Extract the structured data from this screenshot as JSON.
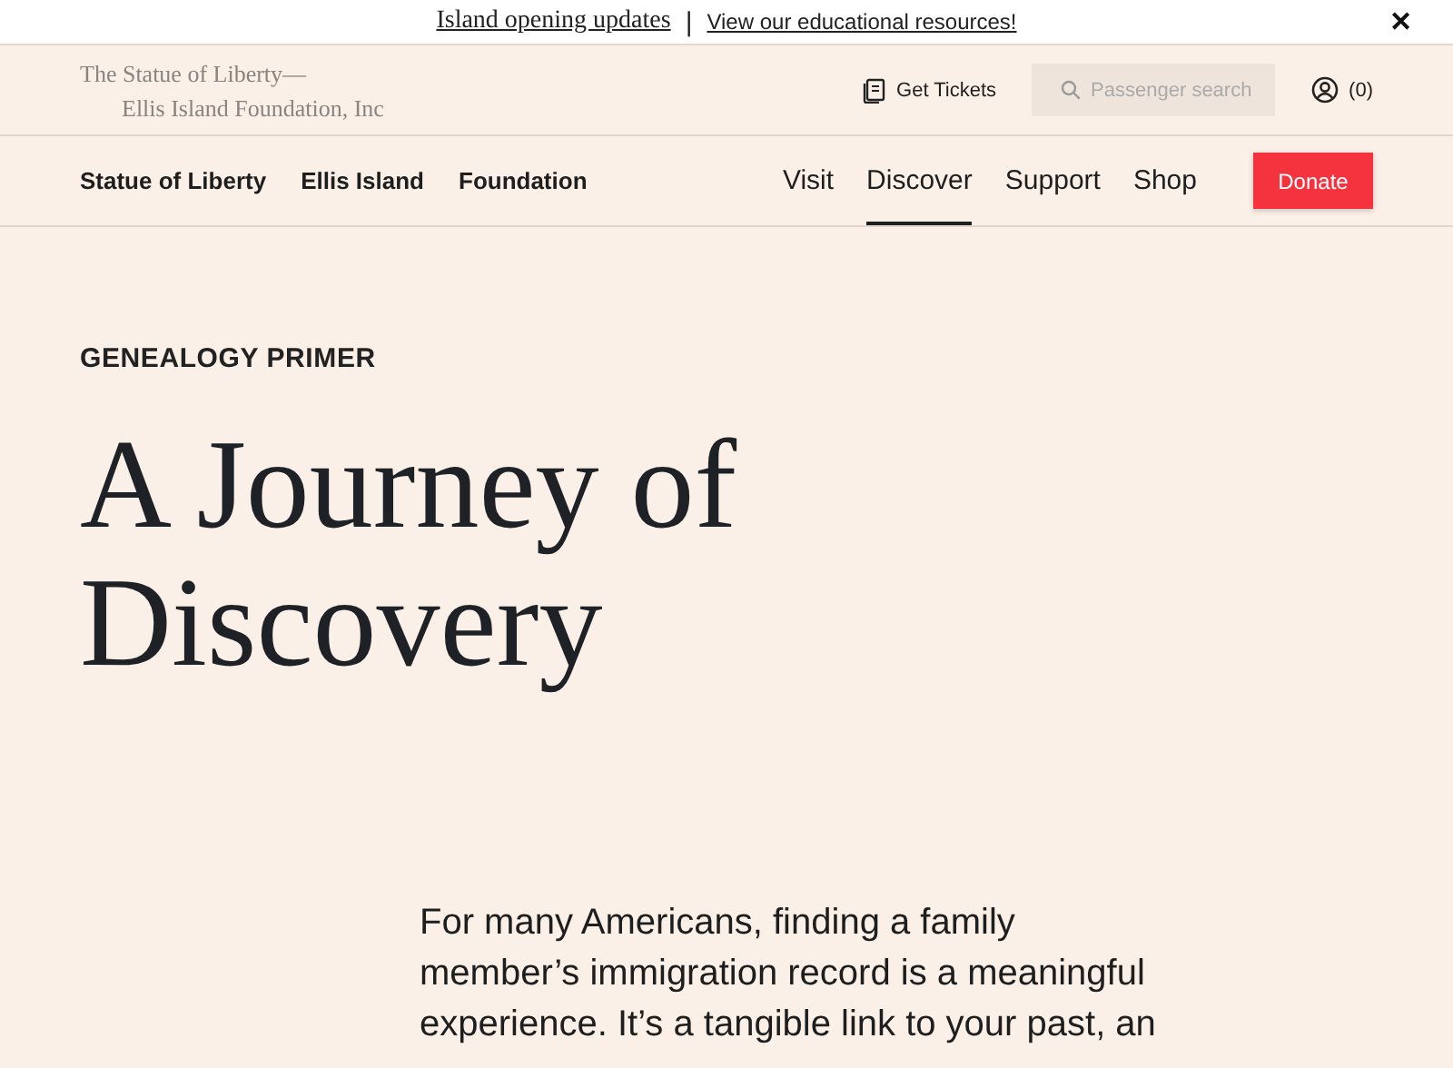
{
  "announcement": {
    "links": [
      "Island opening updates",
      "View our educational resources!"
    ],
    "separator": "|",
    "close": "✕"
  },
  "header": {
    "logo_lines": [
      "The Statue of Liberty—",
      "Ellis Island Foundation, Inc"
    ],
    "tickets": "Get Tickets",
    "search": {
      "placeholder": "Passenger search"
    },
    "cart": "(0)"
  },
  "nav": {
    "left": [
      "Statue of Liberty",
      "Ellis Island",
      "Foundation"
    ],
    "right": [
      {
        "label": "Visit",
        "selected": false
      },
      {
        "label": "Discover",
        "selected": true
      },
      {
        "label": "Support",
        "selected": false
      },
      {
        "label": "Shop",
        "selected": false
      }
    ],
    "donate": "Donate"
  },
  "hero": {
    "eyebrow": "GENEALOGY PRIMER",
    "title_lines": [
      "A Journey of",
      "Discovery"
    ]
  },
  "intro": [
    "For many Americans, finding a family",
    "member’s immigration record is a meaningful",
    "experience. It’s a tangible link to your past, an"
  ]
}
